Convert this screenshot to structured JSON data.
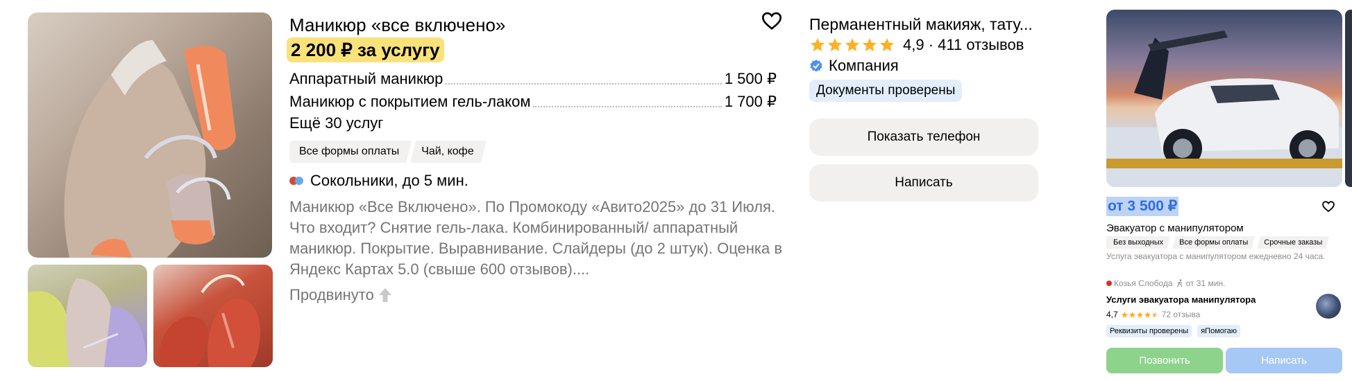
{
  "listing": {
    "title": "Маникюр «все включено»",
    "price": "2 200 ₽ за услугу",
    "services": [
      {
        "name": "Аппаратный маникюр",
        "price": "1 500 ₽"
      },
      {
        "name": "Маникюр с покрытием гель-лаком",
        "price": "1 700 ₽"
      }
    ],
    "more_services": "Ещё 30 услуг",
    "tags": [
      "Все формы оплаты",
      "Чай, кофе"
    ],
    "metro": "Сокольники, до 5 мин.",
    "description": "Маникюр «Все Включено». По Промокоду «Авито2025» до 31 Июля. Что входит? Снятие гель-лака. Комбинированный/ аппаратный маникюр. Покрытие. Выравнивание. Слайдеры (до 2 штук). Оценка в Яндекс Картах 5.0 (свыше 600 отзывов)....",
    "promoted": "Продвинуто",
    "icons": {
      "favorite": "heart-icon",
      "promoted": "arrow-up-icon",
      "metro": "metro-lines-icon"
    }
  },
  "seller": {
    "name": "Перманентный макияж, тату...",
    "rating_text": "4,9 · 411 отзывов",
    "rating_value": 4.9,
    "type": "Компания",
    "docs_badge": "Документы проверены",
    "show_phone": "Показать телефон",
    "write": "Написать",
    "colors": {
      "star": "#ffb021",
      "verified": "#4f8ff0",
      "badge_bg": "#e3eefc",
      "button_bg": "#f1f0ee"
    }
  },
  "ad": {
    "price": "от 3 500 ₽",
    "title": "Эвакуатор с манипулятором",
    "tags": [
      "Без выходных",
      "Все формы оплаты",
      "Срочные заказы"
    ],
    "description": "Услуга эвакуатора с манипулятором ежедневно 24 часа.",
    "location": "Козья Слобода",
    "walk_time": "от 31 мин.",
    "seller_name": "Услуги эвакуатора манипулятора",
    "rating": "4,7",
    "reviews": "72 отзыва",
    "badges": [
      "Реквизиты проверены",
      "яПомогаю"
    ],
    "call_button": "Позвонить",
    "write_button": "Написать",
    "colors": {
      "call": "#8ed38c",
      "write": "#a6c8f5",
      "price": "#2f6de1"
    }
  }
}
